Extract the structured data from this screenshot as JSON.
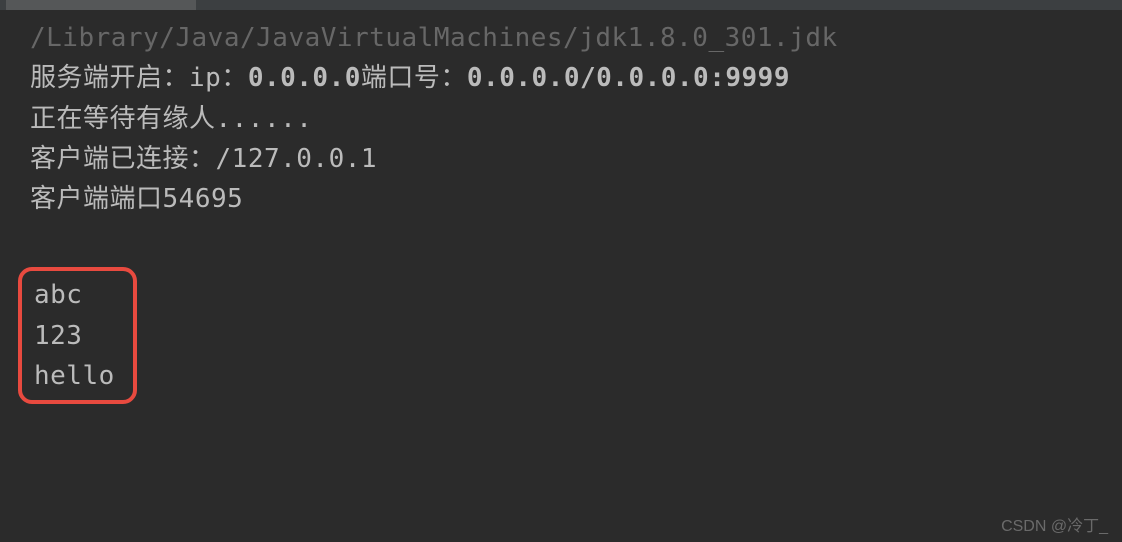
{
  "topbar": {},
  "console": {
    "path": "/Library/Java/JavaVirtualMachines/jdk1.8.0_301.jdk",
    "line1_prefix": "服务端开启：ip：",
    "line1_ip": "0.0.0.0",
    "line1_port_label": "端口号：",
    "line1_port_value": "0.0.0.0/0.0.0.0:9999",
    "line2": "正在等待有缘人......",
    "line3_prefix": "客户端已连接：",
    "line3_value": "/127.0.0.1",
    "line4_prefix": "客户端端口",
    "line4_value": "54695",
    "received": {
      "r1": "abc",
      "r2": "123",
      "r3": "hello"
    }
  },
  "watermark": "CSDN @冷丁_"
}
